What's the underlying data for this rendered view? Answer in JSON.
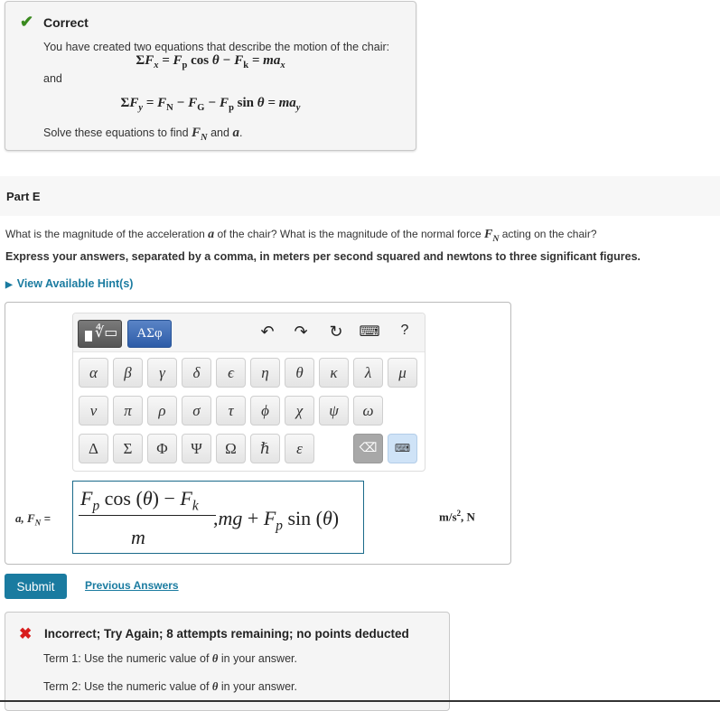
{
  "correct_feedback": {
    "status": "Correct",
    "intro": "You have created two equations that describe the motion of the chair:",
    "equation_x": "ΣFx = Fp cos θ − Fk = max",
    "connector": "and",
    "equation_y": "ΣFy = FN − FG − Fp sin θ = may",
    "solve_prefix": "Solve these equations to find",
    "solve_var1": "FN",
    "solve_and": "and",
    "solve_var2": "a",
    "solve_suffix": "."
  },
  "part": {
    "title": "Part E",
    "question_part1": "What is the magnitude of the acceleration",
    "question_var_a": "a",
    "question_part2": "of the chair? What is the magnitude of the normal force",
    "question_var_fn": "FN",
    "question_part3": "acting on the chair?",
    "instruction": "Express your answers, separated by a comma, in meters per second squared and newtons to three significant figures.",
    "hints_link": "View Available Hint(s)"
  },
  "toolbar": {
    "template_button": "templates",
    "greek_button": "ΑΣφ",
    "undo": "↶",
    "redo": "↷",
    "reset": "↻",
    "keyboard": "⌨",
    "help": "?"
  },
  "greek_keys": {
    "row1": [
      "α",
      "β",
      "γ",
      "δ",
      "ϵ",
      "η",
      "θ",
      "κ",
      "λ",
      "μ"
    ],
    "row2": [
      "ν",
      "π",
      "ρ",
      "σ",
      "τ",
      "ϕ",
      "χ",
      "ψ",
      "ω"
    ],
    "row3": [
      "Δ",
      "Σ",
      "Φ",
      "Ψ",
      "Ω",
      "ℏ",
      "ε"
    ],
    "delete_key": "⌫",
    "keyboard_toggle": "⌨"
  },
  "answer": {
    "label": "a, FN =",
    "numerator": "Fp cos (θ) − Fk",
    "denominator": "m",
    "rest": ",mg + Fp sin (θ)",
    "units": "m/s², N"
  },
  "actions": {
    "submit": "Submit",
    "previous_answers": "Previous Answers"
  },
  "incorrect_feedback": {
    "status": "Incorrect; Try Again; 8 attempts remaining; no points deducted",
    "term1_prefix": "Term 1: Use the numeric value of",
    "term2_prefix": "Term 2: Use the numeric value of",
    "theta": "θ",
    "suffix": "in your answer."
  },
  "colors": {
    "accent": "#1a7ba0",
    "correct": "#3a8a1f",
    "incorrect": "#d81e1e"
  }
}
